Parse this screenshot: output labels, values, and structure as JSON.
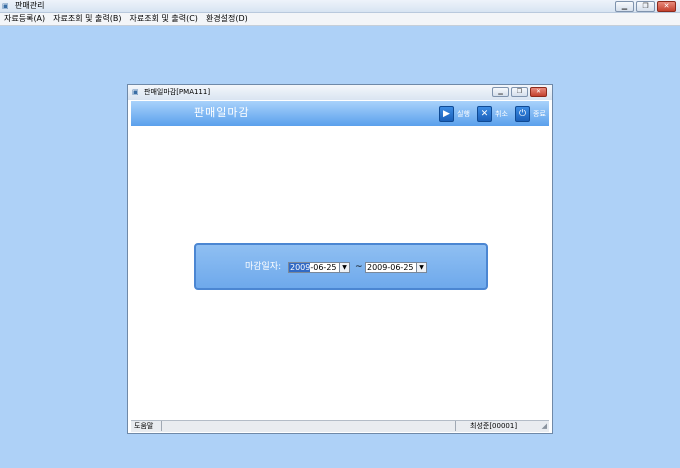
{
  "app": {
    "title": "판매관리"
  },
  "menu": {
    "items": [
      "자료등록(A)",
      "자료조회 및 출력(B)",
      "자료조회 및 출력(C)",
      "환경설정(D)"
    ]
  },
  "child_window": {
    "title": "판매일마감[PMA111]",
    "banner_title": "판매일마감",
    "toolbar": {
      "run_label": "실행",
      "cancel_label": "취소",
      "exit_label": "종료"
    }
  },
  "form": {
    "label": "마감일자:",
    "start_date_selected": "2009",
    "start_date_rest": "-06-25",
    "separator": "~",
    "end_date": "2009-06-25"
  },
  "statusbar": {
    "help": "도움말",
    "user": "최성준[00001]"
  },
  "colors": {
    "desktop": "#aed1f7",
    "banner": "#5aa0ec",
    "selection": "#316ac5"
  }
}
